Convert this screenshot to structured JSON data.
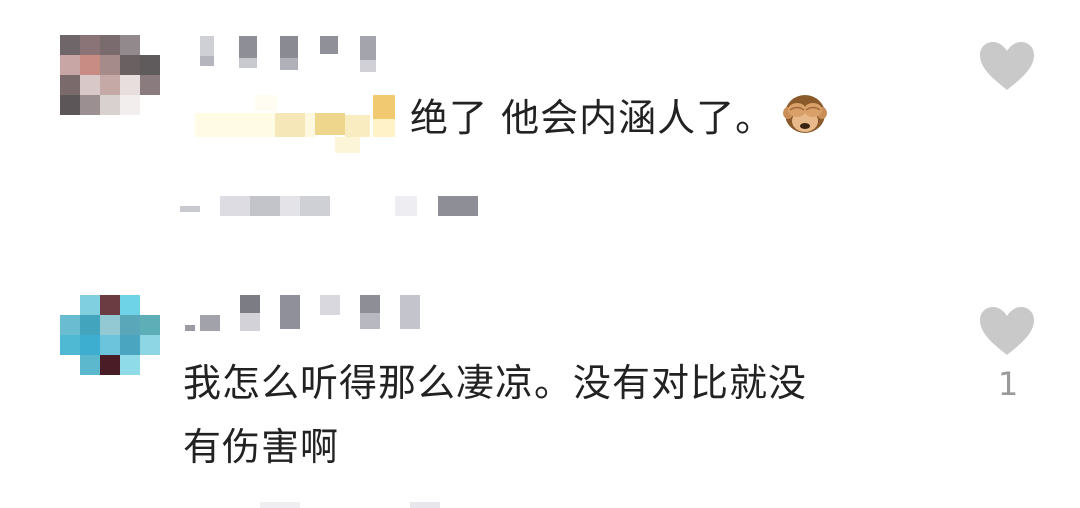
{
  "comments": [
    {
      "text": "绝了 他会内涵人了。",
      "emoji": "see-no-evil-monkey",
      "likes": ""
    },
    {
      "text_line1": "我怎么听得那么凄凉。没有对比就没",
      "text_line2": "有伤害啊",
      "likes": "1"
    }
  ],
  "colors": {
    "heart": "#c9c9c9",
    "text": "#222222",
    "like_count": "#9a9a9a"
  }
}
